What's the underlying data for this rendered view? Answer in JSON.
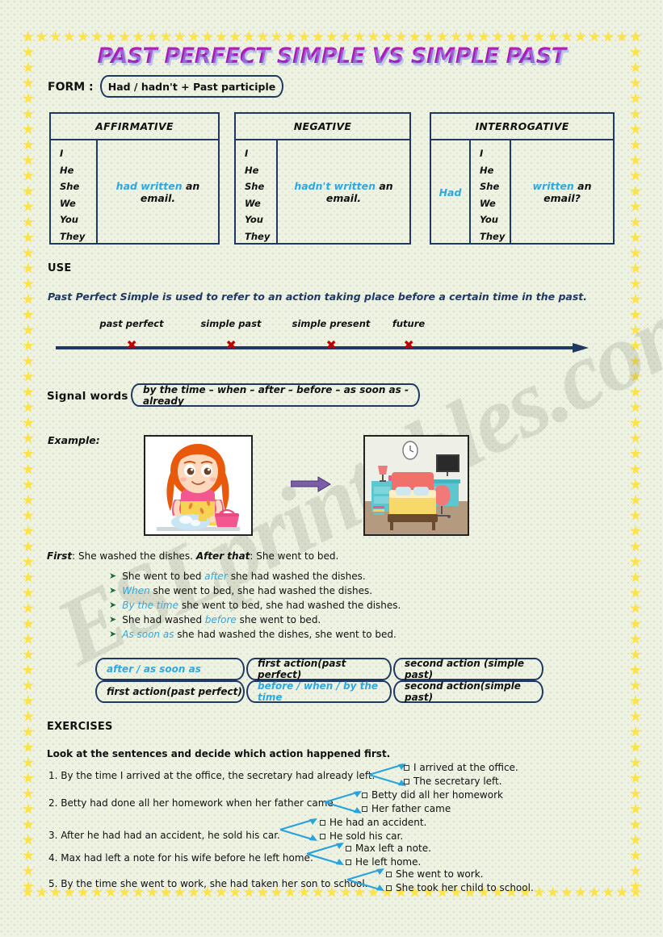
{
  "title": "PAST PERFECT SIMPLE VS SIMPLE PAST",
  "watermark": "ESLprintables.com",
  "form": {
    "label": "FORM :",
    "box": "Had  /  hadn't  + Past participle"
  },
  "tables": [
    {
      "header": "AFFIRMATIVE",
      "aux": "",
      "pronouns": [
        "I",
        "He",
        "She",
        "We",
        "You",
        "They"
      ],
      "sentence_blue": "had written",
      "sentence_black": " an email."
    },
    {
      "header": "NEGATIVE",
      "aux": "",
      "pronouns": [
        "I",
        "He",
        "She",
        "We",
        "You",
        "They"
      ],
      "sentence_blue": "hadn't written",
      "sentence_black": " an email."
    },
    {
      "header": "INTERROGATIVE",
      "aux": "Had",
      "pronouns": [
        "I",
        "He",
        "She",
        "We",
        "You",
        "They"
      ],
      "sentence_blue": "written",
      "sentence_black": " an email?"
    }
  ],
  "use": {
    "heading": "USE",
    "statement": "Past Perfect Simple is used to refer to an action taking place before a certain time in the past."
  },
  "timeline": {
    "labels": [
      "past perfect",
      "simple past",
      "simple present",
      "future"
    ],
    "x_mark": "✖"
  },
  "signal": {
    "label": "Signal words",
    "box": "by the time – when – after – before – as soon as - already"
  },
  "example": {
    "label": "Example:",
    "picture_left": "girl-washing-dishes-illustration",
    "arrow": "purple-arrow-right",
    "picture_right": "bedroom-illustration",
    "first_label": "First",
    "first_text": ": She washed the dishes. ",
    "after_label": "After that",
    "after_text": ": She went to bed.",
    "bullets": [
      {
        "pre": "She went to bed ",
        "blue": "after",
        "post": " she had washed the dishes."
      },
      {
        "pre": "",
        "blue": "When",
        "post": " she went to bed, she had washed the dishes."
      },
      {
        "pre": "",
        "blue": "By the time",
        "post": " she went to bed,  she had washed the dishes."
      },
      {
        "pre": "She had washed ",
        "blue": "before",
        "post": " she went to bed."
      },
      {
        "pre": "",
        "blue": "As soon as",
        "post": " she had washed the dishes, she went to bed."
      }
    ]
  },
  "order_rows": [
    {
      "cells": [
        {
          "text": "after   / as soon as",
          "blue": true
        },
        {
          "text": "first action(past perfect)",
          "blue": false
        },
        {
          "text": "second action (simple past)",
          "blue": false
        }
      ]
    },
    {
      "cells": [
        {
          "text": "first action(past perfect)",
          "blue": false
        },
        {
          "text": "before / when / by the time",
          "blue": true
        },
        {
          "text": "second action(simple past)",
          "blue": false
        }
      ]
    }
  ],
  "exercises": {
    "heading": "EXERCISES",
    "instruction": "Look at the sentences and decide which action happened first.",
    "items": [
      {
        "sentence": "1. By the time I arrived at the office, the secretary had already left.",
        "options": [
          "I arrived at the office.",
          "The secretary left."
        ]
      },
      {
        "sentence": "2. Betty had done all her homework when her father came.",
        "options": [
          "Betty did all her homework",
          "Her father came"
        ]
      },
      {
        "sentence": "3. After he had had an accident, he sold his car.",
        "options": [
          "He had an accident.",
          "He sold his car."
        ]
      },
      {
        "sentence": "4. Max had left a note for his wife before he left home.",
        "options": [
          "Max left a note.",
          "He left home."
        ]
      },
      {
        "sentence": "5. By the time she went to work, she had taken her son to school.",
        "options": [
          "She went to work.",
          "She took her child to school."
        ]
      }
    ]
  },
  "colors": {
    "navy": "#1f3864",
    "cyan": "#2ea8e0",
    "star": "#fbe44b",
    "red_x": "#c00000",
    "arrow_purple": "#7b5ea7",
    "background": "#eef2e3"
  }
}
